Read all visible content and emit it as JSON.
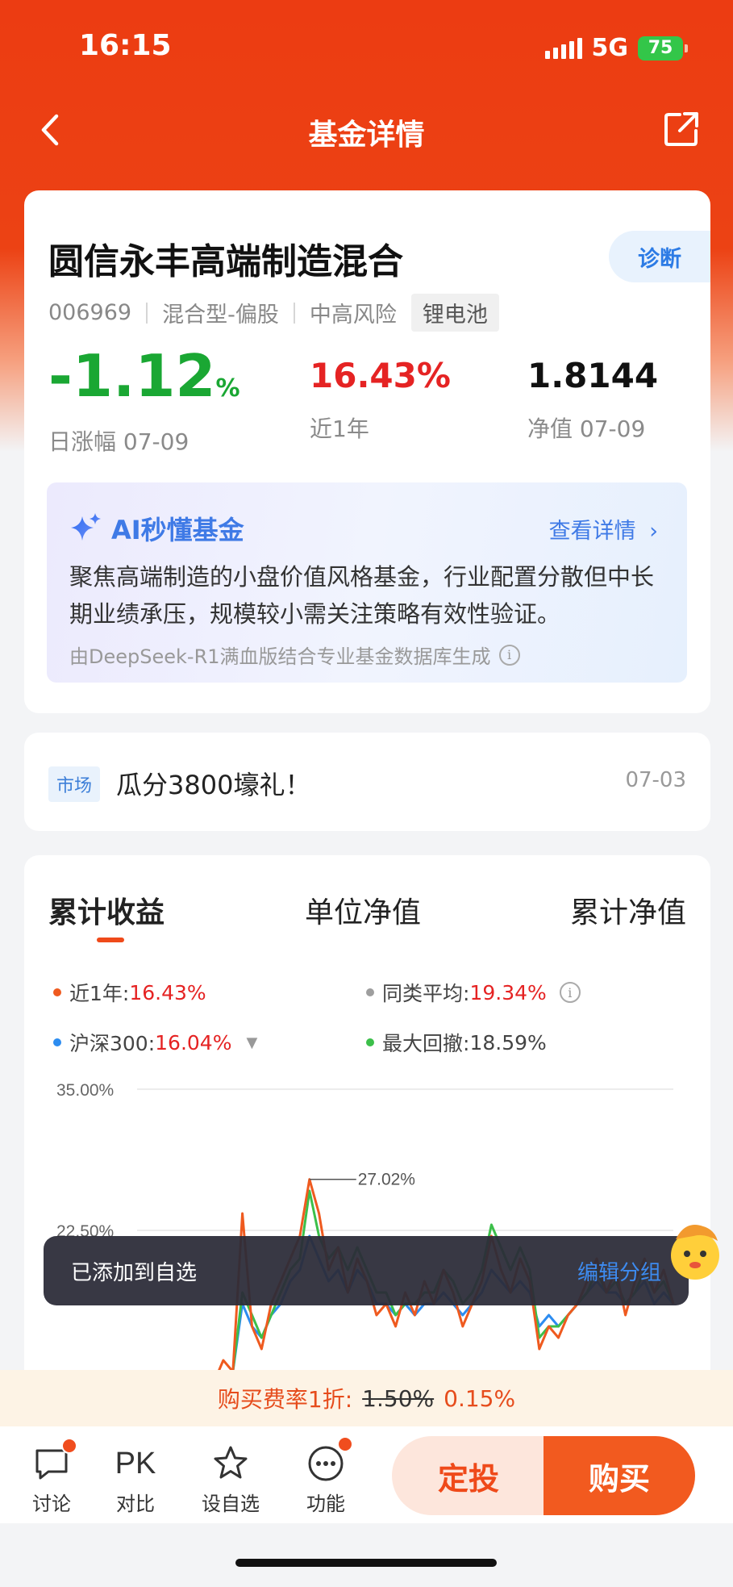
{
  "status": {
    "time": "16:15",
    "network": "5G",
    "battery": "75"
  },
  "nav": {
    "title": "基金详情"
  },
  "fund": {
    "name": "圆信永丰高端制造混合",
    "diagnose": "诊断",
    "code": "006969",
    "type": "混合型-偏股",
    "risk": "中高风险",
    "theme_tag": "锂电池",
    "daily_change": "-1.12",
    "daily_change_unit": "%",
    "daily_label": "日涨幅 07-09",
    "year_return": "16.43%",
    "year_label": "近1年",
    "nav_value": "1.8144",
    "nav_label": "净值 07-09"
  },
  "ai": {
    "title": "AI秒懂基金",
    "more": "查看详情",
    "text": "聚焦高端制造的小盘价值风格基金，行业配置分散但中长期业绩承压，规模较小需关注策略有效性验证。",
    "source": "由DeepSeek-R1满血版结合专业基金数据库生成"
  },
  "market": {
    "tag": "市场",
    "text": "瓜分3800壕礼！",
    "date": "07-03"
  },
  "chart_tabs": [
    "累计收益",
    "单位净值",
    "累计净值"
  ],
  "legend": {
    "year_label": "近1年:",
    "year_value": "16.43%",
    "peer_label": "同类平均:",
    "peer_value": "19.34%",
    "hs300_label": "沪深300:",
    "hs300_value": "16.04%",
    "drawdown_label": "最大回撤:",
    "drawdown_value": "18.59%"
  },
  "colors": {
    "fund": "#ef5a1f",
    "peer": "#9e9e9e",
    "hs300": "#2c8cf0",
    "drawdown": "#3cbf4a"
  },
  "chart_data": {
    "type": "line",
    "ytick_labels": [
      "35.00%",
      "22.50%"
    ],
    "annotation": "27.02%",
    "yticks": [
      35,
      22.5
    ],
    "ylim": [
      5,
      35
    ],
    "peak": 27.02,
    "series": [
      {
        "color": "#ef5a1f",
        "values": [
          6,
          8,
          7,
          9,
          7,
          8,
          6,
          7,
          9,
          11,
          10,
          24,
          14,
          12,
          16,
          18,
          20,
          22,
          27.02,
          24,
          19,
          21,
          17,
          20,
          18,
          15,
          16,
          14,
          17,
          15,
          18,
          16,
          19,
          17,
          14,
          16,
          18,
          22,
          19,
          17,
          20,
          18,
          12,
          14,
          13,
          15,
          16,
          18,
          20,
          17,
          19,
          15,
          18,
          20,
          17,
          19,
          16
        ]
      },
      {
        "color": "#3cbf4a",
        "values": [
          6,
          7,
          6,
          8,
          7,
          7,
          6,
          6,
          8,
          10,
          10,
          17,
          15,
          13,
          15,
          17,
          19,
          20,
          26,
          22,
          20,
          21,
          19,
          21,
          19,
          17,
          17,
          15,
          16,
          16,
          17,
          17,
          19,
          18,
          16,
          17,
          19,
          23,
          21,
          19,
          21,
          19,
          13,
          14,
          14,
          15,
          16,
          17,
          19,
          17,
          18,
          16,
          17,
          19,
          17,
          18,
          16
        ]
      },
      {
        "color": "#2c8cf0",
        "values": [
          6,
          7,
          7,
          8,
          8,
          7,
          6,
          7,
          8,
          10,
          10,
          16,
          14,
          13,
          15,
          16,
          18,
          19,
          22,
          20,
          18,
          19,
          17,
          19,
          18,
          16,
          16,
          15,
          16,
          15,
          16,
          16,
          17,
          16,
          15,
          16,
          17,
          19,
          18,
          17,
          18,
          17,
          14,
          15,
          14,
          15,
          16,
          17,
          18,
          17,
          17,
          16,
          17,
          18,
          16,
          17,
          16
        ]
      }
    ]
  },
  "toast": {
    "text": "已添加到自选",
    "action": "编辑分组"
  },
  "promo": {
    "prefix": "购买费率1折:",
    "old_rate": "1.50%",
    "new_rate": "0.15%"
  },
  "bottom": {
    "discuss": "讨论",
    "compare_icon": "PK",
    "compare": "对比",
    "favorite": "设自选",
    "functions": "功能",
    "auto_invest": "定投",
    "buy": "购买"
  }
}
